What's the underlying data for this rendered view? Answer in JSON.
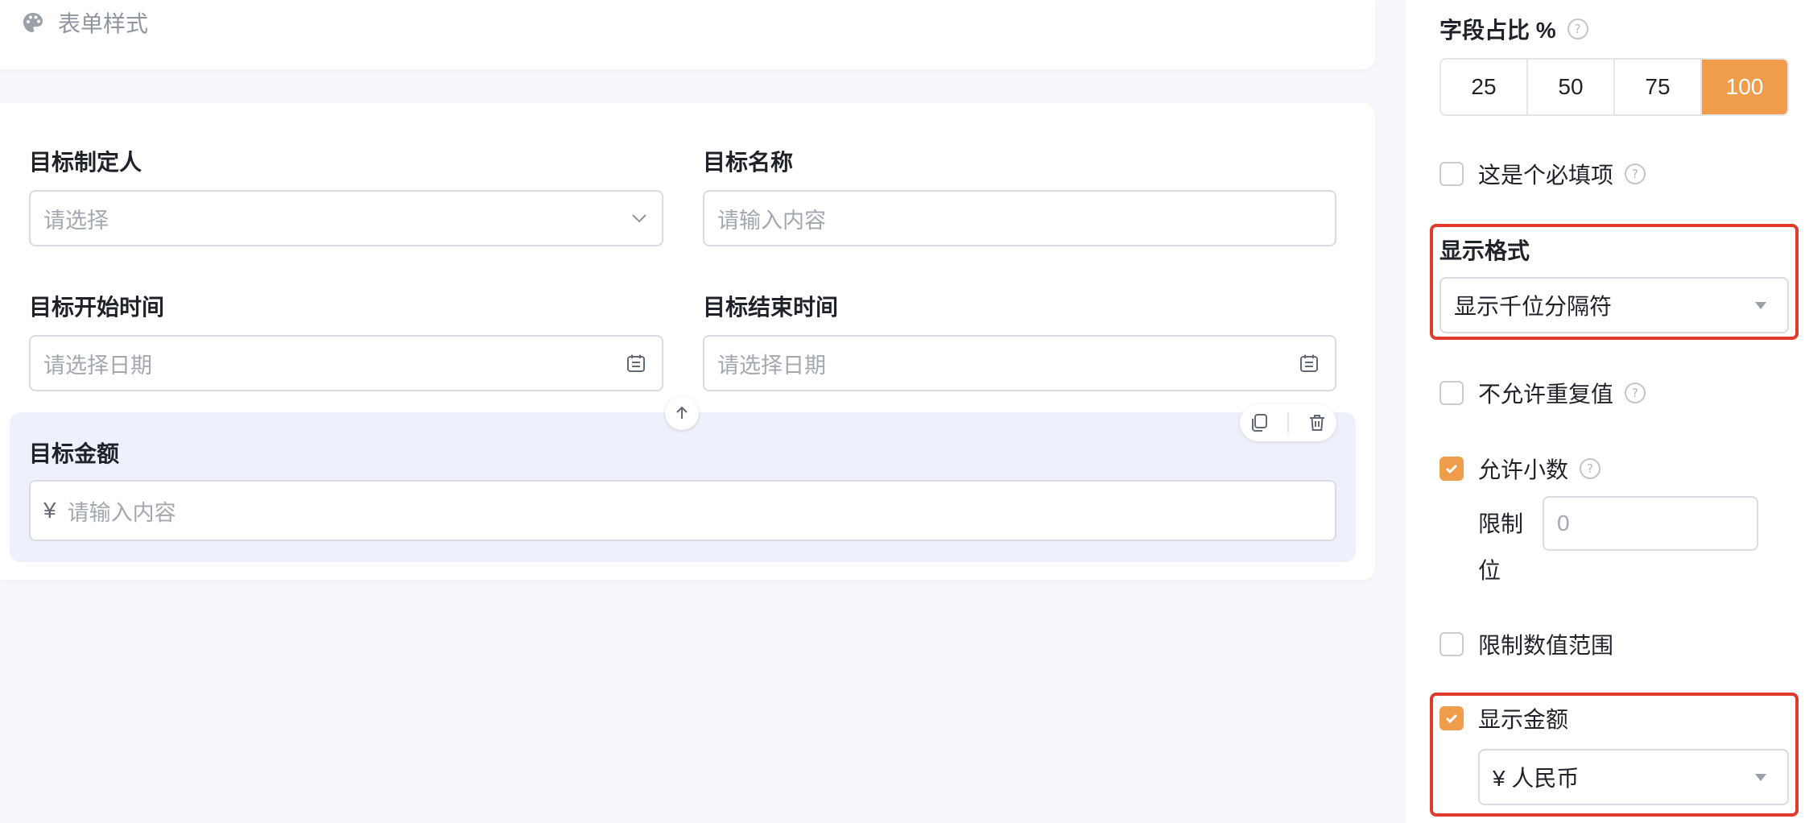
{
  "canvas": {
    "form_style_label": "表单样式",
    "fields": [
      {
        "label": "目标制定人",
        "placeholder": "请选择"
      },
      {
        "label": "目标名称",
        "placeholder": "请输入内容"
      },
      {
        "label": "目标开始时间",
        "placeholder": "请选择日期"
      },
      {
        "label": "目标结束时间",
        "placeholder": "请选择日期"
      },
      {
        "label": "目标金额",
        "prefix": "¥",
        "placeholder": "请输入内容"
      }
    ]
  },
  "panel": {
    "width_ratio": {
      "label": "字段占比 %",
      "options": [
        "25",
        "50",
        "75",
        "100"
      ],
      "selected": "100"
    },
    "required": {
      "label": "这是个必填项",
      "checked": false
    },
    "display_format": {
      "title": "显示格式",
      "value": "显示千位分隔符"
    },
    "no_duplicates": {
      "label": "不允许重复值",
      "checked": false
    },
    "allow_decimal": {
      "label": "允许小数",
      "checked": true
    },
    "decimal_limit": {
      "label": "限制位",
      "value": "0"
    },
    "limit_range": {
      "label": "限制数值范围",
      "checked": false
    },
    "show_amount": {
      "label": "显示金额",
      "checked": true,
      "currency": "¥ 人民币"
    }
  },
  "colors": {
    "accent": "#f09d4b",
    "highlight": "#e03a2c",
    "selected_bg": "#eef1fb"
  }
}
